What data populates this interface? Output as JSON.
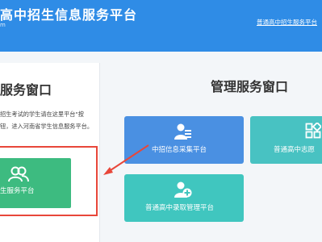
{
  "header": {
    "title": "高中招生信息服务平台",
    "subtitle": "m",
    "link": "普通高中招生服务平台"
  },
  "left_panel": {
    "title": "服务窗口",
    "description": "招生考试的学生请在这里平台\"按钮，进入河南省学生信息服务平台。",
    "student_button": "生服务平台"
  },
  "right_panel": {
    "title": "管理服务窗口",
    "tiles": [
      {
        "label": "中招信息采集平台",
        "icon": "user-list-icon",
        "color": "#4a90e2"
      },
      {
        "label": "普通高中志愿",
        "icon": "grid-icon",
        "color": "#48c2c2"
      },
      {
        "label": "普通高中录取管理平台",
        "icon": "user-add-icon",
        "color": "#40c6bf"
      }
    ]
  },
  "annotation": {
    "color": "#e8473a"
  }
}
